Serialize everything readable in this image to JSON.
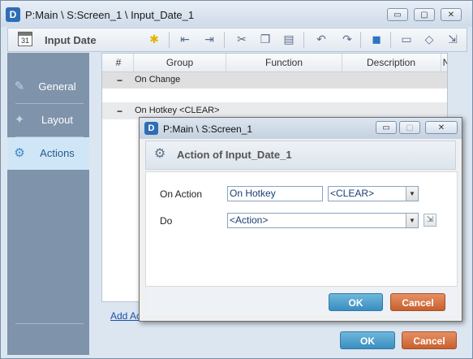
{
  "window": {
    "title": "P:Main \\ S:Screen_1 \\ Input_Date_1",
    "app_icon": "D",
    "controls": {
      "minimize": "▭",
      "restore": "▢",
      "close": "✕"
    }
  },
  "toolbar": {
    "icon_label": "31",
    "title": "Input Date",
    "icons": [
      "lightbulb-icon",
      "outdent-icon",
      "indent-icon",
      "cut-icon",
      "copy-icon",
      "paste-icon",
      "undo-icon",
      "redo-icon",
      "comment-icon",
      "speech-icon",
      "tag-icon",
      "arrow-out-icon"
    ]
  },
  "sidebar": {
    "items": [
      {
        "label": "General",
        "icon": "general-icon",
        "active": false
      },
      {
        "label": "Layout",
        "icon": "layout-icon",
        "active": false
      },
      {
        "label": "Actions",
        "icon": "actions-icon",
        "active": true
      }
    ]
  },
  "grid": {
    "columns": [
      "#",
      "Group",
      "Function",
      "Description",
      "N"
    ],
    "groups": [
      {
        "marker": "−",
        "label": "On Change"
      },
      {
        "marker": "−",
        "label": "On Hotkey <CLEAR>"
      }
    ]
  },
  "add_action_link": "Add Ac",
  "main_buttons": {
    "ok": "OK",
    "cancel": "Cancel"
  },
  "dialog": {
    "title": "P:Main \\ S:Screen_1",
    "app_icon": "D",
    "header": "Action of Input_Date_1",
    "on_action_label": "On Action",
    "on_action_value": "On Hotkey",
    "hotkey_value": "<CLEAR>",
    "do_label": "Do",
    "do_value": "<Action>",
    "ok": "OK",
    "cancel": "Cancel"
  }
}
